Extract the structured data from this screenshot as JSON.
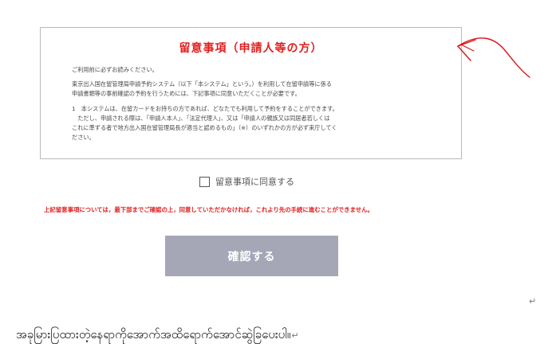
{
  "notice": {
    "title": "留意事項（申請人等の方）",
    "lines": [
      "ご利用前に必ずお読みください。",
      "東京出入国在留管理局申請予約システム（以下「本システム」という。）を利用して在留申請等に係る",
      "申請書類等の事前確認の予約を行うためには、下記事項に同意いただくことが必要です。",
      "1　本システムは、在留カードをお持ちの方であれば、どなたでも利用して予約をすることができます。",
      "　ただし、申請される際は、「申請人本人」、「法定代理人」、又は「申請人の親族又は同居者若しくは",
      "これに準ずる者で地方出入国在留管理局長が適当と認めるもの」（※）のいずれかの方が必ず来庁してく",
      "ださい。"
    ]
  },
  "agree": {
    "label": "留意事項に同意する"
  },
  "warning": "上記留意事項については，最下部までご確認の上，同意していただかなければ，これより先の手続に進むことができません。",
  "confirm_button": {
    "label": "確認する"
  },
  "document": {
    "paragraph_mark": "↵",
    "caption": "အခုမြားပြထားတဲ့နေရာကိုအောက်အထိရောက်အောင်ဆွဲခြပေးပါ။"
  },
  "colors": {
    "accent_red": "#e02020",
    "button_bg": "#a6a7b6"
  }
}
